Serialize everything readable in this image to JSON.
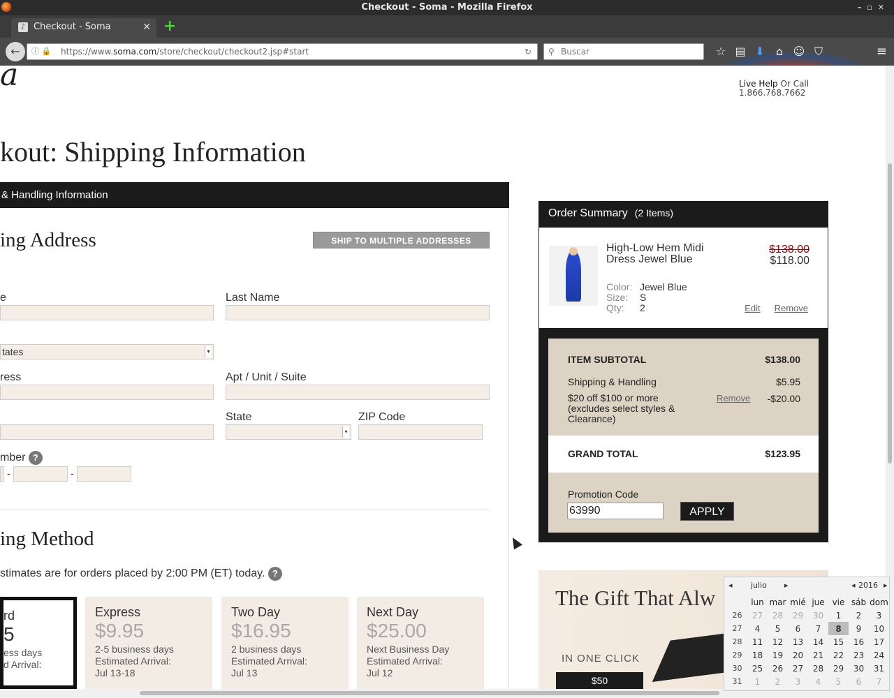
{
  "window": {
    "title": "Checkout - Soma - Mozilla Firefox"
  },
  "tab": {
    "title": "Checkout - Soma",
    "favicon": "soma-favicon"
  },
  "nav": {
    "url_prefix": "https://www.",
    "url_domain": "soma.com",
    "url_path": "/store/checkout/checkout2.jsp#start",
    "search_placeholder": "Buscar"
  },
  "header": {
    "logo_text": "a",
    "live_help": "Live Help",
    "or_call": " Or Call",
    "phone": "1.866.768.7662"
  },
  "page": {
    "title": "kout: Shipping Information",
    "section_bar": "& Handling Information"
  },
  "shipping_address": {
    "heading": "ing Address",
    "multi_button": "SHIP TO MULTIPLE ADDRESSES",
    "first_name_label": "e",
    "last_name_label": "Last Name",
    "country_value": "tates",
    "address_label": "ress",
    "apt_label": "Apt / Unit / Suite",
    "state_label": "State",
    "zip_label": "ZIP Code",
    "phone_label": "mber",
    "phone_sep1": "-",
    "phone_sep2": "-"
  },
  "shipping_method": {
    "heading": "ing Method",
    "estimate_note": "stimates are for orders placed by 2:00 PM (ET) today.",
    "options": [
      {
        "name": "rd",
        "price": "5",
        "desc1": "ess days",
        "desc2": "d Arrival:",
        "desc3": ""
      },
      {
        "name": "Express",
        "price": "$9.95",
        "desc1": "2-5 business days",
        "desc2": "Estimated Arrival:",
        "desc3": "Jul 13-18"
      },
      {
        "name": "Two Day",
        "price": "$16.95",
        "desc1": "2 business days",
        "desc2": "Estimated Arrival:",
        "desc3": "Jul 13"
      },
      {
        "name": "Next Day",
        "price": "$25.00",
        "desc1": "Next Business Day",
        "desc2": "Estimated Arrival:",
        "desc3": "Jul 12"
      }
    ]
  },
  "order_summary": {
    "title": "Order Summary",
    "count": "(2 Items)",
    "item": {
      "name": "High-Low Hem Midi Dress Jewel Blue",
      "old_price": "$138.00",
      "price": "$118.00",
      "color_label": "Color:",
      "color": "Jewel Blue",
      "size_label": "Size:",
      "size": "S",
      "qty_label": "Qty:",
      "qty": "2",
      "edit": "Edit",
      "remove": "Remove"
    },
    "subtotal_label": "ITEM SUBTOTAL",
    "subtotal": "$138.00",
    "shipping_label": "Shipping & Handling",
    "shipping": "$5.95",
    "discount_label": "$20 off $100 or more (excludes select styles & Clearance)",
    "discount_remove": "Remove",
    "discount": "-$20.00",
    "grand_total_label": "GRAND TOTAL",
    "grand_total": "$123.95",
    "promo_label": "Promotion Code",
    "promo_value": "63990",
    "apply": "APPLY"
  },
  "ad": {
    "title": "The Gift That Alw",
    "subtitle": "IN ONE CLICK",
    "button": "$50"
  },
  "calendar": {
    "month": "julio",
    "year": "2016",
    "weekdays": [
      "lun",
      "mar",
      "mié",
      "jue",
      "vie",
      "sáb",
      "dom"
    ],
    "weeks": [
      {
        "wk": "26",
        "days": [
          "27",
          "28",
          "29",
          "30",
          "1",
          "2",
          "3"
        ]
      },
      {
        "wk": "27",
        "days": [
          "4",
          "5",
          "6",
          "7",
          "8",
          "9",
          "10"
        ]
      },
      {
        "wk": "28",
        "days": [
          "11",
          "12",
          "13",
          "14",
          "15",
          "16",
          "17"
        ]
      },
      {
        "wk": "29",
        "days": [
          "18",
          "19",
          "20",
          "21",
          "22",
          "23",
          "24"
        ]
      },
      {
        "wk": "30",
        "days": [
          "25",
          "26",
          "27",
          "28",
          "29",
          "30",
          "31"
        ]
      },
      {
        "wk": "31",
        "days": [
          "1",
          "2",
          "3",
          "4",
          "5",
          "6",
          "7"
        ]
      }
    ],
    "today": "8"
  }
}
